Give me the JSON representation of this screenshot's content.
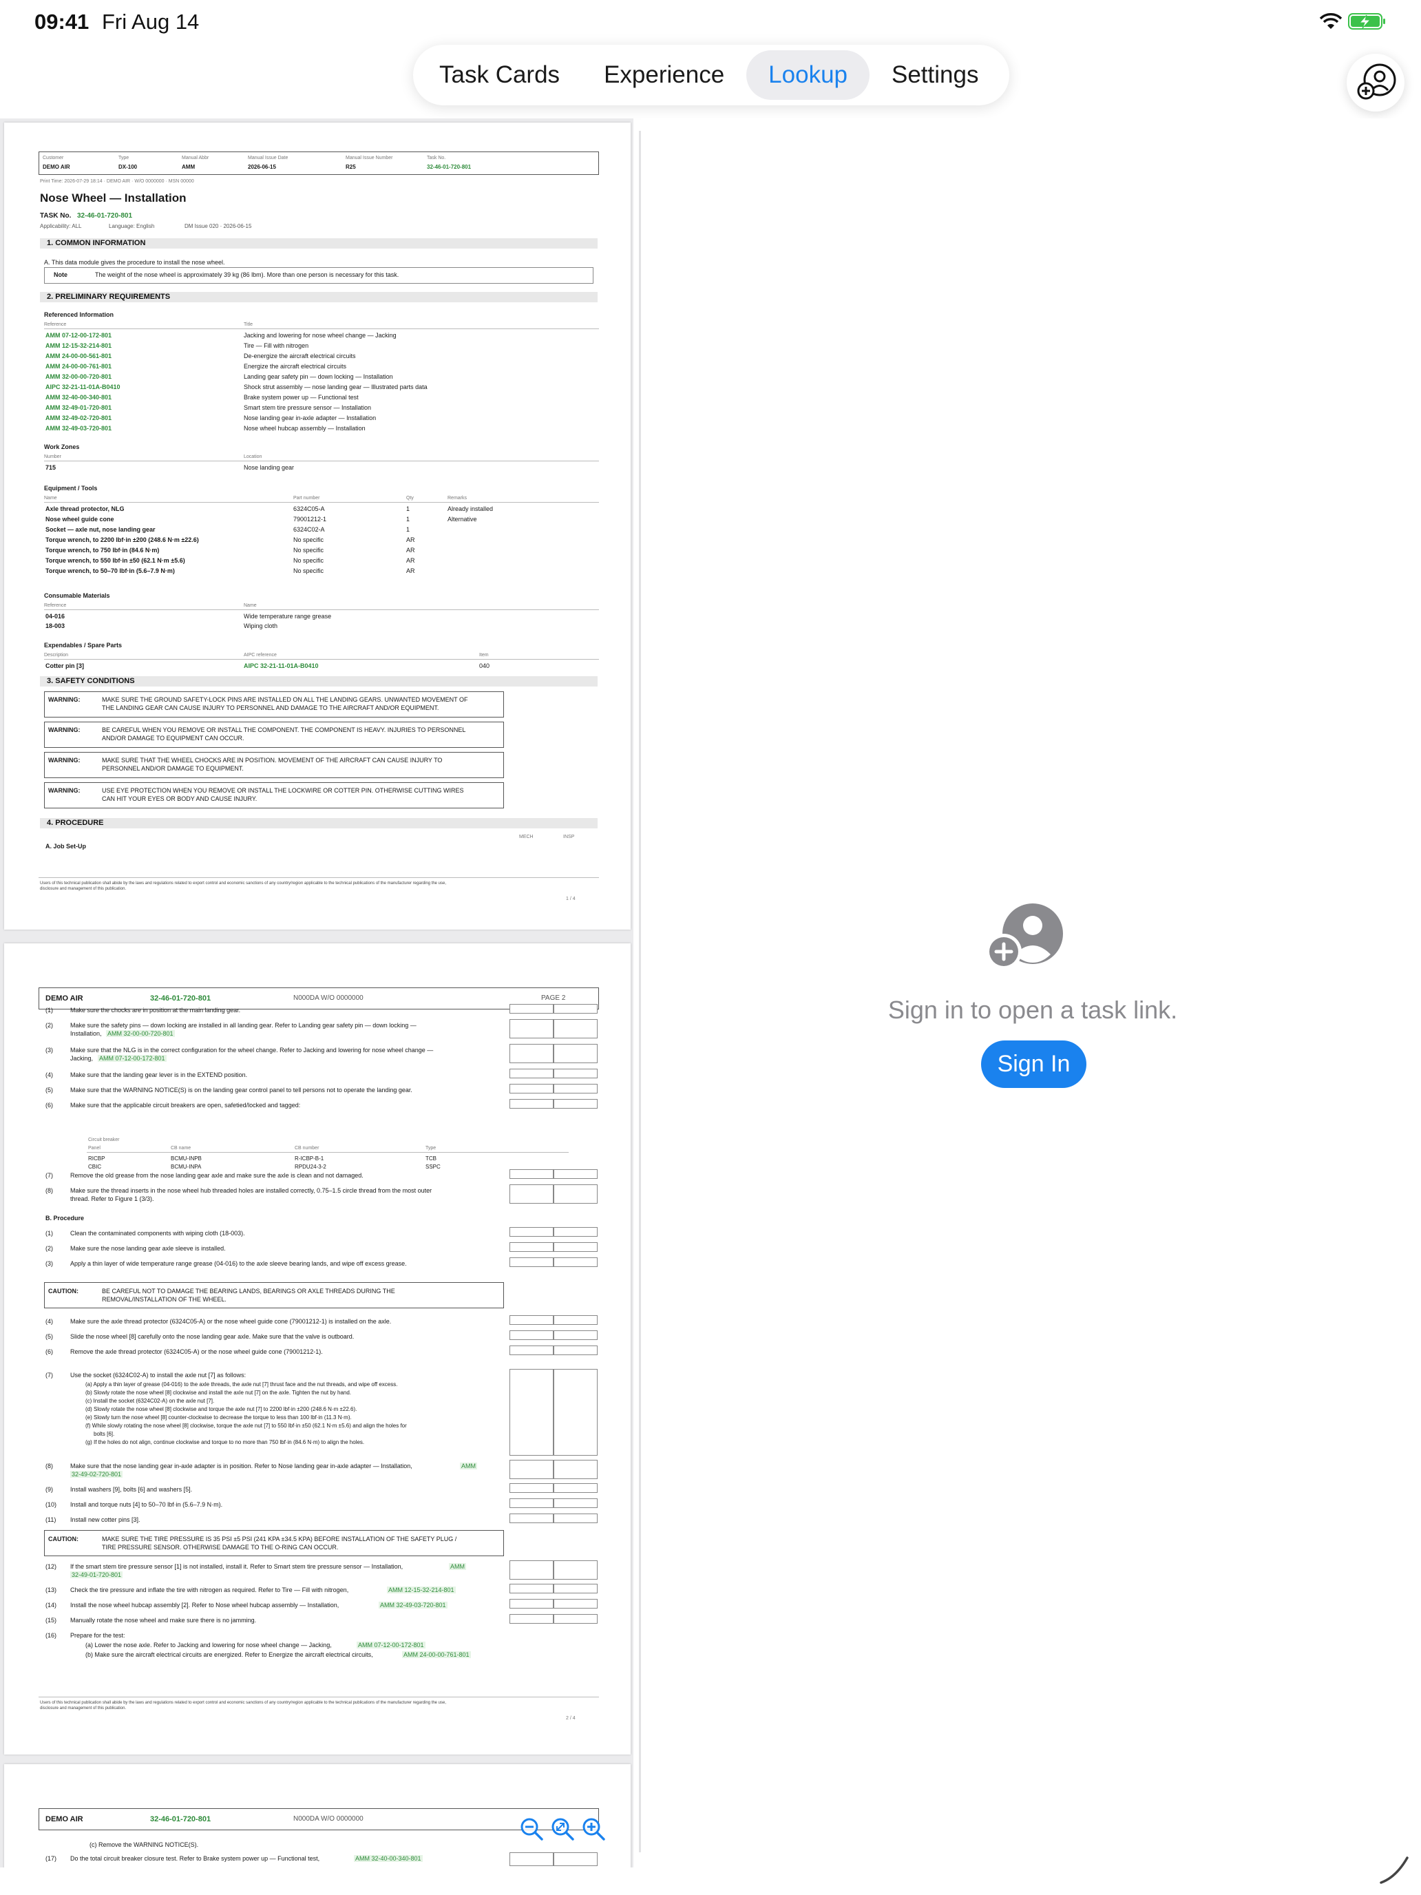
{
  "status_bar": {
    "time": "09:41",
    "date": "Fri Aug 14"
  },
  "tabs": [
    {
      "label": "Task Cards"
    },
    {
      "label": "Experience"
    },
    {
      "label": "Lookup"
    },
    {
      "label": "Settings"
    }
  ],
  "active_tab": "Lookup",
  "icons": {
    "account": "person-add-icon",
    "wifi": "wifi-icon",
    "battery": "battery-charging-icon",
    "zoom_out": "zoom-out-icon",
    "zoom_reset": "zoom-reset-icon",
    "zoom_in": "zoom-in-icon"
  },
  "colors": {
    "accent": "#1a82ee",
    "link_green": "#2e8b3a",
    "battery": "#3bc14a"
  },
  "right_pane": {
    "message": "Sign in to open a task link.",
    "button": "Sign In"
  },
  "page1": {
    "header_labels": [
      "Customer",
      "Type",
      "Manual Abbr",
      "Manual Issue Date",
      "Manual Issue Number",
      "Task No."
    ],
    "header_values": [
      "DEMO AIR",
      "DX-100",
      "AMM",
      "2026-06-15",
      "R25",
      "32-46-01-720-801"
    ],
    "print_line": "Print Time: 2026-07-29 18:14 · DEMO AIR · W/O 0000000 · MSN 00000",
    "title": "Nose Wheel — Installation",
    "task_prefix": "TASK No.",
    "task_no": "32-46-01-720-801",
    "applicability": "Applicability: ALL",
    "language": "Language: English",
    "dm_issue": "DM Issue 020 · 2026-06-15",
    "s1": "1.  COMMON INFORMATION",
    "s1_text": "A. This data module gives the procedure to install the nose wheel.",
    "note_label": "Note",
    "note_text": "The weight of the nose wheel is approximately 39 kg (86 lbm). More than one person is necessary for this task.",
    "s2": "2.  PRELIMINARY REQUIREMENTS",
    "ref_heading": "Referenced Information",
    "ref_cols": [
      "Reference",
      "Title"
    ],
    "refs": [
      {
        "ref": "AMM 07-12-00-172-801",
        "title": "Jacking and lowering for nose wheel change — Jacking"
      },
      {
        "ref": "AMM 12-15-32-214-801",
        "title": "Tire — Fill with nitrogen"
      },
      {
        "ref": "AMM 24-00-00-561-801",
        "title": "De-energize the aircraft electrical circuits"
      },
      {
        "ref": "AMM 24-00-00-761-801",
        "title": "Energize the aircraft electrical circuits"
      },
      {
        "ref": "AMM 32-00-00-720-801",
        "title": "Landing gear safety pin — down locking — Installation"
      },
      {
        "ref": "AIPC 32-21-11-01A-B0410",
        "title": "Shock strut assembly — nose landing gear — Illustrated parts data"
      },
      {
        "ref": "AMM 32-40-00-340-801",
        "title": "Brake system power up — Functional test"
      },
      {
        "ref": "AMM 32-49-01-720-801",
        "title": "Smart stem tire pressure sensor — Installation"
      },
      {
        "ref": "AMM 32-49-02-720-801",
        "title": "Nose landing gear in-axle adapter — Installation"
      },
      {
        "ref": "AMM 32-49-03-720-801",
        "title": "Nose wheel hubcap assembly — Installation"
      }
    ],
    "wz_heading": "Work Zones",
    "wz_cols": [
      "Number",
      "Location"
    ],
    "wz": {
      "number": "715",
      "location": "Nose landing gear"
    },
    "eq_heading": "Equipment / Tools",
    "eq_cols": [
      "Name",
      "Part number",
      "Qty",
      "Remarks"
    ],
    "equipment": [
      {
        "name": "Axle thread protector, NLG",
        "pn": "6324C05-A",
        "qty": "1",
        "rem": "Already installed"
      },
      {
        "name": "Nose wheel guide cone",
        "pn": "79001212-1",
        "qty": "1",
        "rem": "Alternative"
      },
      {
        "name": "Socket — axle nut, nose landing gear",
        "pn": "6324C02-A",
        "qty": "1",
        "rem": ""
      },
      {
        "name": "Torque wrench, to 2200 lbf·in ±200 (248.6 N·m ±22.6)",
        "pn": "No specific",
        "qty": "AR",
        "rem": ""
      },
      {
        "name": "Torque wrench, to 750 lbf·in (84.6 N·m)",
        "pn": "No specific",
        "qty": "AR",
        "rem": ""
      },
      {
        "name": "Torque wrench, to 550 lbf·in ±50 (62.1 N·m ±5.6)",
        "pn": "No specific",
        "qty": "AR",
        "rem": ""
      },
      {
        "name": "Torque wrench, to 50–70 lbf·in (5.6–7.9 N·m)",
        "pn": "No specific",
        "qty": "AR",
        "rem": ""
      }
    ],
    "cons_heading": "Consumable Materials",
    "cons_cols": [
      "Reference",
      "Name"
    ],
    "consumables": [
      {
        "ref": "04-016",
        "name": "Wide temperature range grease"
      },
      {
        "ref": "18-003",
        "name": "Wiping cloth"
      }
    ],
    "exp_heading": "Expendables / Spare Parts",
    "exp_cols": [
      "Description",
      "AIPC reference",
      "Item"
    ],
    "exp": {
      "desc": "Cotter pin [3]",
      "aipc": "AIPC 32-21-11-01A-B0410",
      "item": "040"
    },
    "s3": "3.  SAFETY CONDITIONS",
    "warn_label": "WARNING:",
    "warnings": [
      {
        "l1": "MAKE SURE THE GROUND SAFETY-LOCK PINS ARE INSTALLED ON ALL THE LANDING GEARS. UNWANTED MOVEMENT OF",
        "l2": "THE LANDING GEAR CAN CAUSE INJURY TO PERSONNEL AND DAMAGE TO THE AIRCRAFT AND/OR EQUIPMENT."
      },
      {
        "l1": "BE CAREFUL WHEN YOU REMOVE OR INSTALL THE COMPONENT. THE COMPONENT IS HEAVY. INJURIES TO PERSONNEL",
        "l2": "AND/OR DAMAGE TO EQUIPMENT CAN OCCUR."
      },
      {
        "l1": "MAKE SURE THAT THE WHEEL CHOCKS ARE IN POSITION. MOVEMENT OF THE AIRCRAFT CAN CAUSE INJURY TO",
        "l2": "PERSONNEL AND/OR DAMAGE TO EQUIPMENT."
      },
      {
        "l1": "USE EYE PROTECTION WHEN YOU REMOVE OR INSTALL THE LOCKWIRE OR COTTER PIN. OTHERWISE CUTTING WIRES",
        "l2": "CAN HIT YOUR EYES OR BODY AND CAUSE INJURY."
      }
    ],
    "s4": "4.  PROCEDURE",
    "mech": "MECH",
    "insp": "INSP",
    "job_setup": "A.   Job Set-Up",
    "footer1": "Users of this technical publication shall abide by the laws and regulations related to export control and economic sanctions of any country/region applicable to the technical publications of the manufacturer regarding the use,",
    "footer2": "disclosure and management of this publication.",
    "page_no": "1 / 4"
  },
  "page2": {
    "company": "DEMO AIR",
    "task": "32-46-01-720-801",
    "code": "N000DA   W/O 0000000",
    "page": "PAGE 2",
    "steps_a": [
      {
        "n": "(1)",
        "t": "Make sure the chocks are in position at the main landing gear.",
        "t2": "",
        "l": ""
      },
      {
        "n": "(2)",
        "t": "Make sure the safety pins — down locking are installed in all landing gear. Refer to Landing gear safety pin — down locking —",
        "t2": "Installation,",
        "l": "AMM 32-00-00-720-801"
      },
      {
        "n": "(3)",
        "t": "Make sure that the NLG is in the correct configuration for the wheel change. Refer to Jacking and lowering for nose wheel change —",
        "t2": "Jacking,",
        "l": "AMM 07-12-00-172-801"
      },
      {
        "n": "(4)",
        "t": "Make sure that the landing gear lever is in the EXTEND position.",
        "t2": "",
        "l": ""
      },
      {
        "n": "(5)",
        "t": "Make sure that the WARNING NOTICE(S) is on the landing gear control panel to tell persons not to operate the landing gear.",
        "t2": "",
        "l": ""
      },
      {
        "n": "(6)",
        "t": "Make sure that the applicable circuit breakers are open, safetied/locked and tagged:",
        "t2": "",
        "l": ""
      }
    ],
    "cb_heading": "Circuit breaker",
    "cb_cols": [
      "Panel",
      "CB name",
      "CB number",
      "Type"
    ],
    "cbs": [
      {
        "panel": "RICBP",
        "name": "BCMU-INPB",
        "num": "R-ICBP-B-1",
        "type": "TCB"
      },
      {
        "panel": "CBIC",
        "name": "BCMU-INPA",
        "num": "RPDU24-3-2",
        "type": "SSPC"
      }
    ],
    "step7": "Remove the old grease from the nose landing gear axle and make sure the axle is clean and not damaged.",
    "step8a": "Make sure the thread inserts in the nose wheel hub threaded holes are installed correctly, 0.75–1.5 circle thread from the most outer",
    "step8b": "thread. Refer to Figure 1 (3/3).",
    "b_heading": "B.   Procedure",
    "steps_b1": [
      {
        "n": "(1)",
        "t": "Clean the contaminated components with wiping cloth (18-003)."
      },
      {
        "n": "(2)",
        "t": "Make sure the nose landing gear axle sleeve is installed."
      },
      {
        "n": "(3)",
        "t": "Apply a thin layer of wide temperature range grease (04-016) to the axle sleeve bearing lands, and wipe off excess grease."
      }
    ],
    "caution_label": "CAUTION:",
    "caution1a": "BE CAREFUL NOT TO DAMAGE THE BEARING LANDS, BEARINGS OR AXLE THREADS DURING THE",
    "caution1b": "REMOVAL/INSTALLATION OF THE WHEEL.",
    "steps_b2": [
      {
        "n": "(4)",
        "t": "Make sure the axle thread protector (6324C05-A) or the nose wheel guide cone (79001212-1) is installed on the axle."
      },
      {
        "n": "(5)",
        "t": "Slide the nose wheel [8] carefully onto the nose landing gear axle. Make sure that the valve is outboard."
      },
      {
        "n": "(6)",
        "t": "Remove the axle thread protector (6324C05-A) or the nose wheel guide cone (79001212-1)."
      }
    ],
    "step7b_n": "(7)",
    "step7b": "Use the socket (6324C02-A) to install the axle nut [7] as follows:",
    "step7_sub": [
      "(a) Apply a thin layer of grease (04-016) to the axle threads, the axle nut [7] thrust face and the nut threads, and wipe off excess.",
      "(b) Slowly rotate the nose wheel [8] clockwise and install the axle nut [7] on the axle. Tighten the nut by hand.",
      "(c) Install the socket (6324C02-A) on the axle nut [7].",
      "(d) Slowly rotate the nose wheel [8] clockwise and torque the axle nut [7] to 2200 lbf·in ±200 (248.6 N·m ±22.6).",
      "(e) Slowly turn the nose wheel [8] counter-clockwise to decrease the torque to less than 100 lbf·in (11.3 N·m).",
      "(f) While slowly rotating the nose wheel [8] clockwise, torque the axle nut [7] to 550 lbf·in ±50 (62.1 N·m ±5.6) and align the holes for",
      "bolts [6].",
      "(g) If the holes do not align, continue clockwise and torque to no more than 750 lbf·in (84.6 N·m) to align the holes."
    ],
    "step8p": "Make sure that the nose landing gear in-axle adapter is in position. Refer to Nose landing gear in-axle adapter — Installation,",
    "step8p_l1": "AMM",
    "step8p_l2": "32-49-02-720-801",
    "steps_b3": [
      {
        "n": "(9)",
        "t": "Install washers [9], bolts [6] and washers [5]."
      },
      {
        "n": "(10)",
        "t": "Install and torque nuts [4] to 50–70 lbf·in (5.6–7.9 N·m)."
      },
      {
        "n": "(11)",
        "t": "Install new cotter pins [3]."
      }
    ],
    "caution2a": "MAKE SURE THE TIRE PRESSURE IS 35 PSI ±5 PSI (241 KPA ±34.5 KPA) BEFORE INSTALLATION OF THE SAFETY PLUG /",
    "caution2b": "TIRE PRESSURE SENSOR. OTHERWISE DAMAGE TO THE O-RING CAN OCCUR.",
    "step12": "If the smart stem tire pressure sensor [1] is not installed, install it. Refer to Smart stem tire pressure sensor — Installation,",
    "step12_l1": "AMM",
    "step12_l2": "32-49-01-720-801",
    "step13": "Check the tire pressure and inflate the tire with nitrogen as required. Refer to Tire — Fill with nitrogen,",
    "step13_l": "AMM 12-15-32-214-801",
    "step14": "Install the nose wheel hubcap assembly [2]. Refer to Nose wheel hubcap assembly — Installation,",
    "step14_l": "AMM 32-49-03-720-801",
    "step15": "Manually rotate the nose wheel and make sure there is no jamming.",
    "step16": "Prepare for the test:",
    "step16a": "(a) Lower the nose axle. Refer to Jacking and lowering for nose wheel change — Jacking,",
    "step16a_l": "AMM 07-12-00-172-801",
    "step16b": "(b) Make sure the aircraft electrical circuits are energized. Refer to Energize the aircraft electrical circuits,",
    "step16b_l": "AMM 24-00-00-761-801",
    "footer1": "Users of this technical publication shall abide by the laws and regulations related to export control and economic sanctions of any country/region applicable to the technical publications of the manufacturer regarding the use,",
    "footer2": "disclosure and management of this publication.",
    "page_no": "2 / 4"
  },
  "page3": {
    "company": "DEMO AIR",
    "task": "32-46-01-720-801",
    "code": "N000DA   W/O 0000000",
    "line_c": "(c) Remove the WARNING NOTICE(S).",
    "step17_n": "(17)",
    "step17": "Do the total circuit breaker closure test. Refer to Brake system power up — Functional test,",
    "step17_l": "AMM 32-40-00-340-801"
  }
}
